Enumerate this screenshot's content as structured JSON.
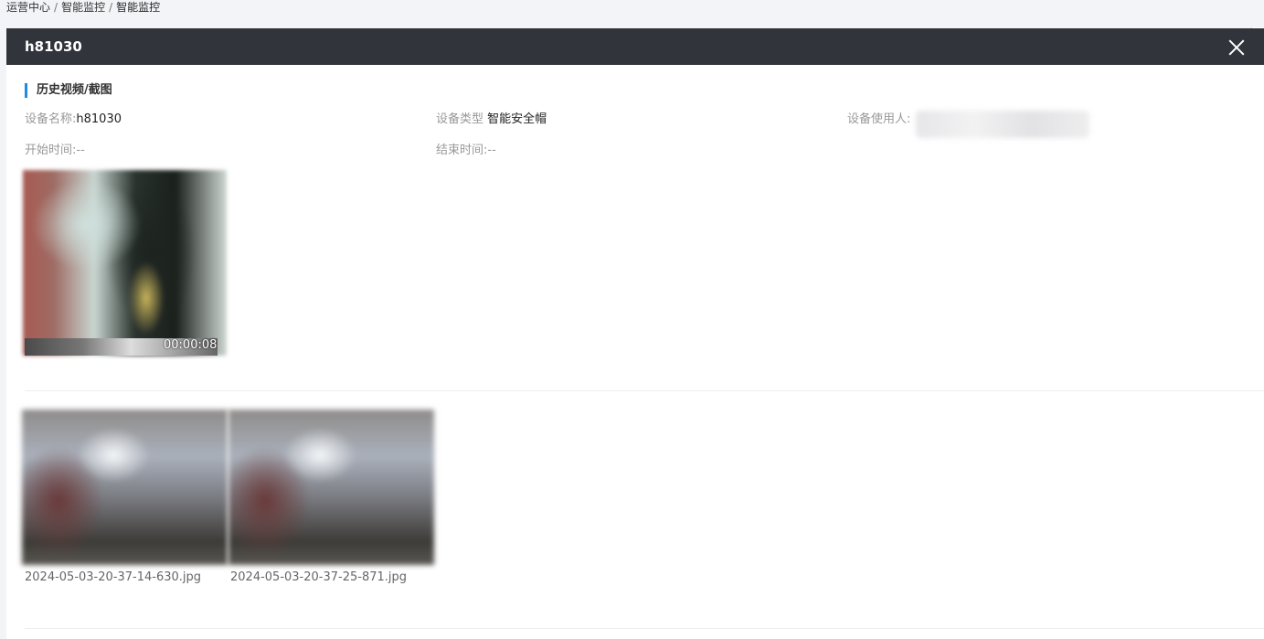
{
  "breadcrumb": {
    "items": [
      "运营中心",
      "智能监控",
      "智能监控"
    ],
    "separator": "/"
  },
  "collapse_icon": "double-chevron-left-icon",
  "collapse_glyph": "«",
  "panel": {
    "title": "h81030",
    "close_icon": "close-icon",
    "header_bg": "#31343b",
    "section_title": "历史视频/截图",
    "accent_color": "#1d8be0"
  },
  "info": {
    "device_name_label": "设备名称:",
    "device_name_value": "h81030",
    "device_type_label": "设备类型",
    "device_type_value": "智能安全帽",
    "device_user_label": "设备使用人:",
    "start_time_label": "开始时间:",
    "start_time_value": "--",
    "end_time_label": "结束时间:",
    "end_time_value": "--"
  },
  "videos": [
    {
      "duration": "00:00:08"
    }
  ],
  "images": [
    {
      "filename": "2024-05-03-20-37-14-630.jpg"
    },
    {
      "filename": "2024-05-03-20-37-25-871.jpg"
    }
  ]
}
